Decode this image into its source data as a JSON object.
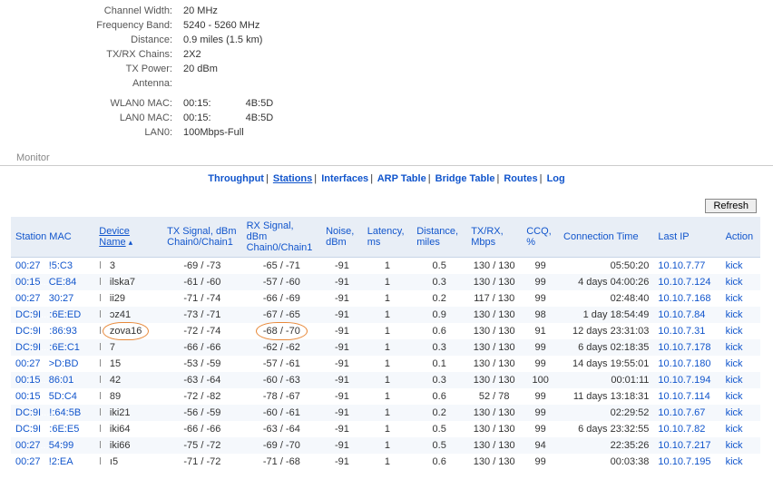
{
  "info": {
    "channel_width_label": "Channel Width:",
    "channel_width": "20 MHz",
    "freq_band_label": "Frequency Band:",
    "freq_band": "5240 - 5260 MHz",
    "distance_label": "Distance:",
    "distance": "0.9 miles (1.5 km)",
    "txrx_chains_label": "TX/RX Chains:",
    "txrx_chains": "2X2",
    "tx_power_label": "TX Power:",
    "tx_power": "20 dBm",
    "antenna_label": "Antenna:",
    "antenna": "",
    "wlan0_mac_label": "WLAN0 MAC:",
    "wlan0_mac1": "00:15:",
    "wlan0_mac2": "4B:5D",
    "lan0_mac_label": "LAN0 MAC:",
    "lan0_mac1": "00:15:",
    "lan0_mac2": "4B:5D",
    "lan0_label": "LAN0:",
    "lan0": "100Mbps-Full"
  },
  "monitor_label": "Monitor",
  "nav": {
    "throughput": "Throughput",
    "stations": "Stations",
    "interfaces": "Interfaces",
    "arp": "ARP Table",
    "bridge": "Bridge Table",
    "routes": "Routes",
    "log": "Log"
  },
  "refresh_label": "Refresh",
  "headers": {
    "mac": "Station MAC",
    "dev": "Device Name",
    "sort": "▴",
    "tx": "TX Signal, dBm",
    "tx_sub": "Chain0/Chain1",
    "rx": "RX Signal, dBm",
    "rx_sub": "Chain0/Chain1",
    "noise": "Noise, dBm",
    "lat": "Latency, ms",
    "dist": "Distance, miles",
    "txrx": "TX/RX, Mbps",
    "ccq": "CCQ, %",
    "conn": "Connection Time",
    "ip": "Last IP",
    "act": "Action"
  },
  "kick_label": "kick",
  "rows": [
    {
      "mac1": "00:27",
      "mac2": "!5:C3",
      "dev": "3",
      "tx": "-69 / -73",
      "rx": "-65 / -71",
      "noise": "-91",
      "lat": "1",
      "dist": "0.5",
      "txrx": "130 / 130",
      "ccq": "99",
      "conn": "05:50:20",
      "ip": "10.10.7.77",
      "circleDev": false,
      "circleRx": false
    },
    {
      "mac1": "00:15",
      "mac2": "CE:84",
      "dev": "ilska7",
      "tx": "-61 / -60",
      "rx": "-57 / -60",
      "noise": "-91",
      "lat": "1",
      "dist": "0.3",
      "txrx": "130 / 130",
      "ccq": "99",
      "conn": "4 days 04:00:26",
      "ip": "10.10.7.124",
      "circleDev": false,
      "circleRx": false
    },
    {
      "mac1": "00:27",
      "mac2": "30:27",
      "dev": "ii29",
      "tx": "-71 / -74",
      "rx": "-66 / -69",
      "noise": "-91",
      "lat": "1",
      "dist": "0.2",
      "txrx": "117 / 130",
      "ccq": "99",
      "conn": "02:48:40",
      "ip": "10.10.7.168",
      "circleDev": false,
      "circleRx": false
    },
    {
      "mac1": "DC:9I",
      "mac2": ":6E:ED",
      "dev": "ɔz41",
      "tx": "-73 / -71",
      "rx": "-67 / -65",
      "noise": "-91",
      "lat": "1",
      "dist": "0.9",
      "txrx": "130 / 130",
      "ccq": "98",
      "conn": "1 day 18:54:49",
      "ip": "10.10.7.84",
      "circleDev": false,
      "circleRx": false
    },
    {
      "mac1": "DC:9I",
      "mac2": ":86:93",
      "dev": "zova16",
      "tx": "-72 / -74",
      "rx": "-68 / -70",
      "noise": "-91",
      "lat": "1",
      "dist": "0.6",
      "txrx": "130 / 130",
      "ccq": "91",
      "conn": "12 days 23:31:03",
      "ip": "10.10.7.31",
      "circleDev": true,
      "circleRx": true
    },
    {
      "mac1": "DC:9I",
      "mac2": ":6E:C1",
      "dev": "7",
      "tx": "-66 / -66",
      "rx": "-62 / -62",
      "noise": "-91",
      "lat": "1",
      "dist": "0.3",
      "txrx": "130 / 130",
      "ccq": "99",
      "conn": "6 days 02:18:35",
      "ip": "10.10.7.178",
      "circleDev": false,
      "circleRx": false
    },
    {
      "mac1": "00:27",
      "mac2": ">D:BD",
      "dev": "15",
      "tx": "-53 / -59",
      "rx": "-57 / -61",
      "noise": "-91",
      "lat": "1",
      "dist": "0.1",
      "txrx": "130 / 130",
      "ccq": "99",
      "conn": "14 days 19:55:01",
      "ip": "10.10.7.180",
      "circleDev": false,
      "circleRx": false
    },
    {
      "mac1": "00:15",
      "mac2": "86:01",
      "dev": "42",
      "tx": "-63 / -64",
      "rx": "-60 / -63",
      "noise": "-91",
      "lat": "1",
      "dist": "0.3",
      "txrx": "130 / 130",
      "ccq": "100",
      "conn": "00:01:11",
      "ip": "10.10.7.194",
      "circleDev": false,
      "circleRx": false
    },
    {
      "mac1": "00:15",
      "mac2": "5D:C4",
      "dev": "89",
      "tx": "-72 / -82",
      "rx": "-78 / -67",
      "noise": "-91",
      "lat": "1",
      "dist": "0.6",
      "txrx": "52 / 78",
      "ccq": "99",
      "conn": "11 days 13:18:31",
      "ip": "10.10.7.114",
      "circleDev": false,
      "circleRx": false
    },
    {
      "mac1": "DC:9I",
      "mac2": "!:64:5B",
      "dev": "iki21",
      "tx": "-56 / -59",
      "rx": "-60 / -61",
      "noise": "-91",
      "lat": "1",
      "dist": "0.2",
      "txrx": "130 / 130",
      "ccq": "99",
      "conn": "02:29:52",
      "ip": "10.10.7.67",
      "circleDev": false,
      "circleRx": false
    },
    {
      "mac1": "DC:9I",
      "mac2": ":6E:E5",
      "dev": "iki64",
      "tx": "-66 / -66",
      "rx": "-63 / -64",
      "noise": "-91",
      "lat": "1",
      "dist": "0.5",
      "txrx": "130 / 130",
      "ccq": "99",
      "conn": "6 days 23:32:55",
      "ip": "10.10.7.82",
      "circleDev": false,
      "circleRx": false
    },
    {
      "mac1": "00:27",
      "mac2": "54:99",
      "dev": "iki66",
      "tx": "-75 / -72",
      "rx": "-69 / -70",
      "noise": "-91",
      "lat": "1",
      "dist": "0.5",
      "txrx": "130 / 130",
      "ccq": "94",
      "conn": "22:35:26",
      "ip": "10.10.7.217",
      "circleDev": false,
      "circleRx": false
    },
    {
      "mac1": "00:27",
      "mac2": "!2:EA",
      "dev": "ı5",
      "tx": "-71 / -72",
      "rx": "-71 / -68",
      "noise": "-91",
      "lat": "1",
      "dist": "0.6",
      "txrx": "130 / 130",
      "ccq": "99",
      "conn": "00:03:38",
      "ip": "10.10.7.195",
      "circleDev": false,
      "circleRx": false
    }
  ]
}
